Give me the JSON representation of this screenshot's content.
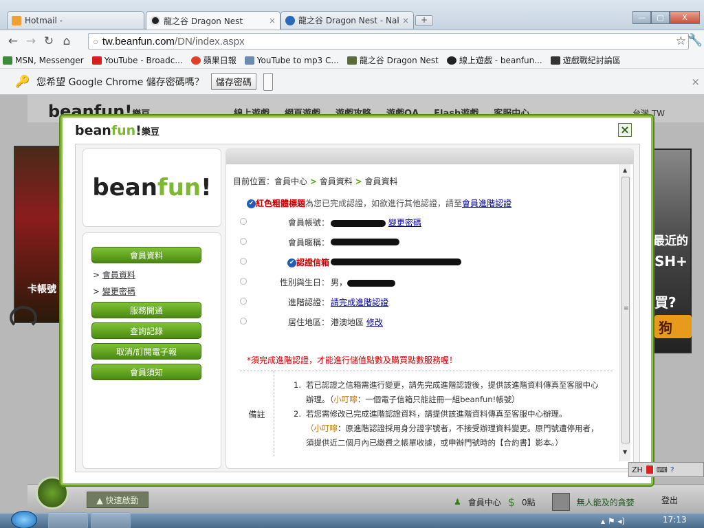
{
  "browser": {
    "tabs": [
      {
        "title": "Hotmail - ",
        "close": "×"
      },
      {
        "title": "龍之谷 Dragon Nest",
        "close": "×"
      },
      {
        "title": "龍之谷 Dragon Nest - Nak",
        "close": "×"
      }
    ],
    "new_tab": "+",
    "window_buttons": {
      "minimize": "—",
      "maximize": "▢",
      "close": "X"
    },
    "url_host": "tw.beanfun.com",
    "url_path": "/DN/index.aspx",
    "bookmarks": [
      "MSN, Messenger",
      "YouTube - Broadc...",
      "蘋果日報",
      "YouTube to mp3 C...",
      "龍之谷 Dragon Nest",
      "線上遊戲 - beanfun...",
      "遊戲戰紀討論區"
    ],
    "infobar": {
      "text": "您希望 Google Chrome 儲存密碼嗎？",
      "save": "儲存密碼",
      "close": "×"
    }
  },
  "site": {
    "logo": "beanfun!",
    "logo_cn": "樂豆",
    "nav": [
      "線上遊戲",
      "網頁遊戲",
      "遊戲攻略",
      "遊戲QA",
      "Flash遊戲",
      "客服中心"
    ],
    "lang": "台灣 TW",
    "left_banner_text": "卡帳號",
    "right_banner": [
      "最近的",
      "SH+",
      "買?",
      "狗"
    ],
    "footer": {
      "quick_start": "▲ 快速啟動",
      "member": "會員中心",
      "points": "0點",
      "nickname": "無人能及的貪婪",
      "logout": "登出"
    }
  },
  "modal": {
    "logo_a": "bean",
    "logo_b": "fun",
    "logo_c": "!",
    "logo_cn": "樂豆",
    "close": "×",
    "side_logo_a": "bean",
    "side_logo_b": "fun",
    "side_logo_c": "!",
    "menu": {
      "member_data": "會員資料",
      "sub_member_data": "會員資料",
      "sub_change_pw": "變更密碼",
      "service": "服務開通",
      "records": "查詢記錄",
      "newsletter": "取消/訂閱電子報",
      "notice": "會員須知"
    },
    "breadcrumb": {
      "prefix": "目前位置：",
      "a": "會員中心",
      "b": "會員資料",
      "c": "會員資料"
    },
    "legend": {
      "red": "紅色粗體標題",
      "text": "為您已完成認證，如欲進行其他認證，請至",
      "link": "會員進階認證"
    },
    "rows": {
      "account_label": "會員帳號：",
      "change_pw": "變更密碼",
      "nick_label": "會員暱稱：",
      "email_label": "認證信箱",
      "birth_label": "性別與生日：",
      "gender": "男，",
      "adv_label": "進階認證：",
      "adv_link": "請完成進階認證",
      "region_label": "居住地區：",
      "region": "港澳地區",
      "region_edit": "修改"
    },
    "warning": "*須完成進階認證，才能進行儲值點數及購買點數服務喔！",
    "notes": {
      "header": "備註",
      "n1": "1.",
      "item1_a": "若已認證之信箱需進行變更，請先完成進階認證後，提供該進階資料傳真至客服中心",
      "item1_b": "辦理。（",
      "item1_hint": "小叮嚀",
      "item1_c": "：一個電子信箱只能註冊一組beanfun!帳號）",
      "n2": "2.",
      "item2_a": "若您需修改已完成進階認證資料，請提供該進階資料傳真至客服中心辦理。",
      "item2_hint": "（小叮嚀",
      "item2_b": "：原進階認證採用身分證字號者，不接受辦理資料變更。原門號遭停用者，",
      "item2_c": "須提供近二個月內已繳費之帳單收據，或申辦門號時的【合約書】影本。）"
    }
  },
  "taskbar": {
    "time": "17:13",
    "ime": "ZH"
  }
}
